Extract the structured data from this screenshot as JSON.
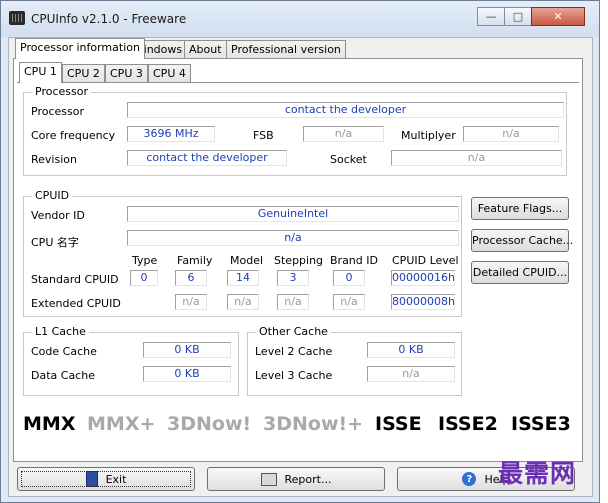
{
  "window": {
    "title": "CPUInfo v2.1.0 - Freeware",
    "controls": {
      "minimize": "—",
      "maximize": "□",
      "close": "✕"
    }
  },
  "main_tabs": [
    "Processor information",
    "Windows",
    "About",
    "Professional version"
  ],
  "cpu_tabs": [
    "CPU 1",
    "CPU 2",
    "CPU 3",
    "CPU 4"
  ],
  "processor": {
    "group": "Processor",
    "processor_label": "Processor",
    "processor_value": "contact the developer",
    "core_frequency_label": "Core frequency",
    "core_frequency_value": "3696 MHz",
    "fsb_label": "FSB",
    "fsb_value": "n/a",
    "multiplyer_label": "Multiplyer",
    "multiplyer_value": "n/a",
    "revision_label": "Revision",
    "revision_value": "contact the developer",
    "socket_label": "Socket",
    "socket_value": "n/a"
  },
  "cpuid": {
    "group": "CPUID",
    "vendor_label": "Vendor ID",
    "vendor_value": "GenuineIntel",
    "name_label": "CPU 名字",
    "name_value": "n/a",
    "headers": [
      "Type",
      "Family",
      "Model",
      "Stepping",
      "Brand ID",
      "CPUID Level"
    ],
    "standard_label": "Standard CPUID",
    "standard_values": [
      "0",
      "6",
      "14",
      "3",
      "0",
      "00000016h"
    ],
    "extended_label": "Extended CPUID",
    "extended_values": [
      "n/a",
      "n/a",
      "n/a",
      "n/a",
      "80000008h"
    ]
  },
  "side_buttons": [
    "Feature Flags...",
    "Processor Cache...",
    "Detailed CPUID..."
  ],
  "l1_cache": {
    "group": "L1 Cache",
    "code_label": "Code Cache",
    "code_value": "0 KB",
    "data_label": "Data Cache",
    "data_value": "0 KB"
  },
  "other_cache": {
    "group": "Other Cache",
    "l2_label": "Level 2 Cache",
    "l2_value": "0 KB",
    "l3_label": "Level 3 Cache",
    "l3_value": "n/a"
  },
  "features": [
    {
      "name": "MMX",
      "enabled": true
    },
    {
      "name": "MMX+",
      "enabled": false
    },
    {
      "name": "3DNow!",
      "enabled": false
    },
    {
      "name": "3DNow!+",
      "enabled": false
    },
    {
      "name": "ISSE",
      "enabled": true
    },
    {
      "name": "ISSE2",
      "enabled": true
    },
    {
      "name": "ISSE3",
      "enabled": true
    }
  ],
  "bottom_buttons": {
    "exit": "Exit",
    "report": "Report...",
    "help": "Help"
  },
  "watermark": "最需网",
  "colors": {
    "value_blue": "#1d3fb5",
    "watermark": "#6b2fb3",
    "disabled": "#9a9a9a"
  }
}
